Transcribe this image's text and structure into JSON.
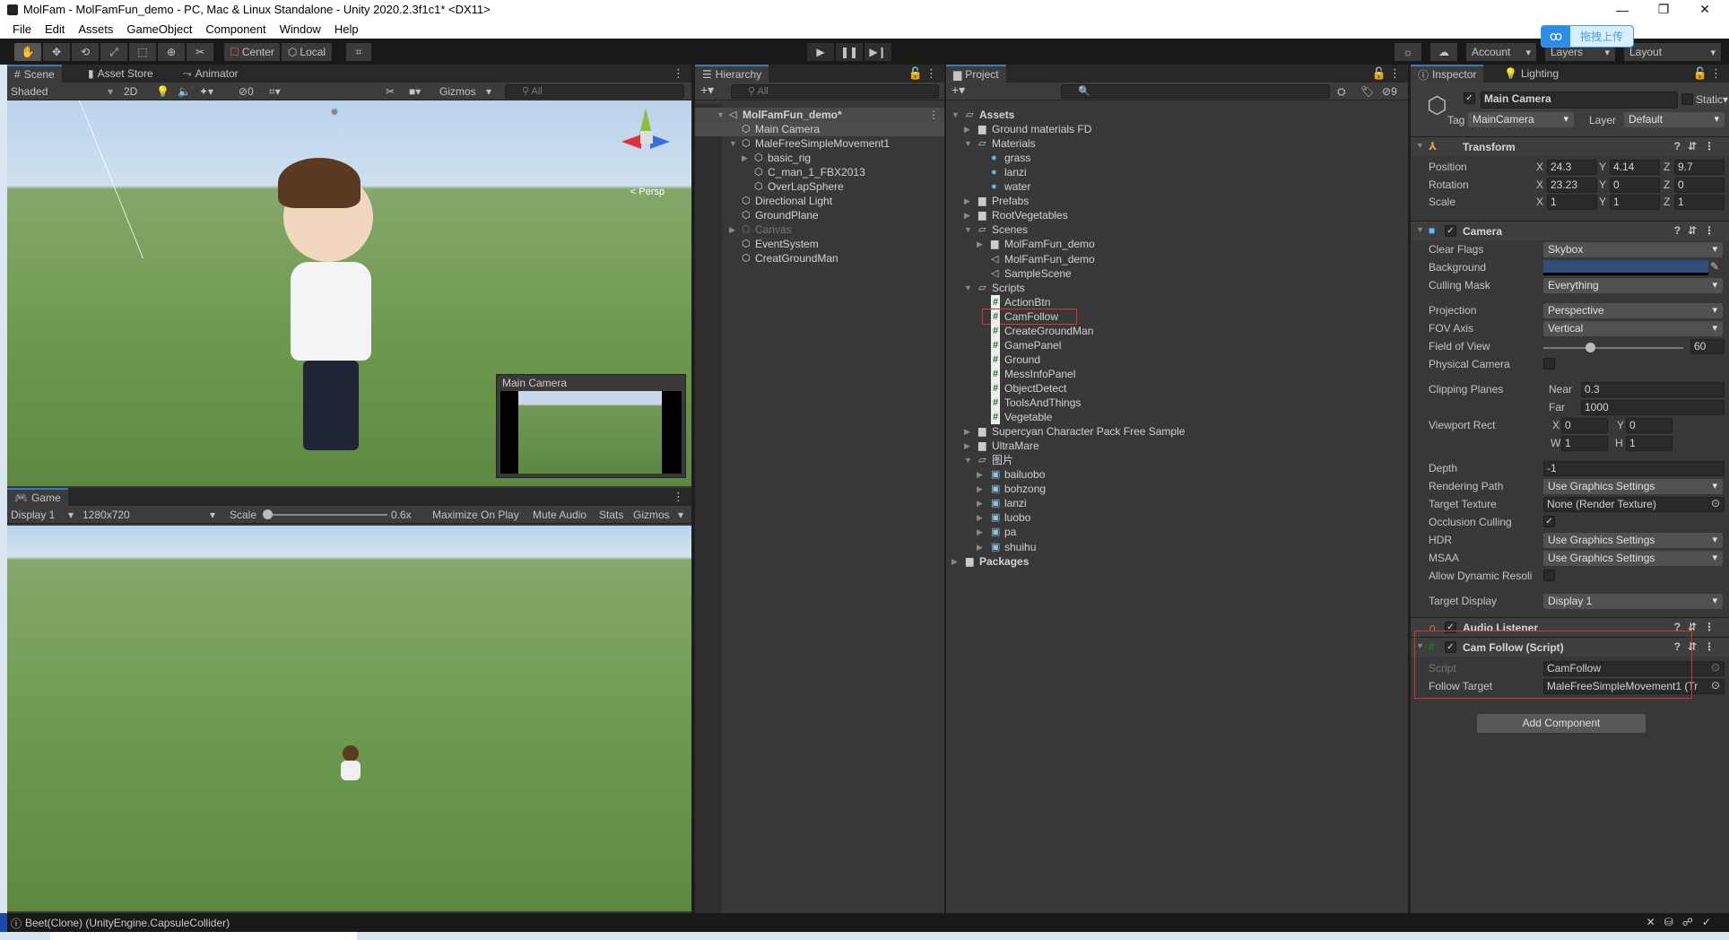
{
  "window": {
    "title": "MolFam - MolFamFun_demo - PC, Mac & Linux Standalone - Unity 2020.2.3f1c1* <DX11>",
    "minimize": "—",
    "restore": "❐",
    "close": "✕"
  },
  "menu": [
    "File",
    "Edit",
    "Assets",
    "GameObject",
    "Component",
    "Window",
    "Help"
  ],
  "toolbar": {
    "center": "Center",
    "local": "Local",
    "account": "Account",
    "layers": "Layers",
    "layout": "Layout",
    "upload": "拖拽上传"
  },
  "scene": {
    "tabs": [
      "Scene",
      "Asset Store",
      "Animator"
    ],
    "shading": "Shaded",
    "mode2d": "2D",
    "hidden_count": "0",
    "gizmos": "Gizmos",
    "search_placeholder": "All",
    "persp": "< Persp",
    "camera_preview_title": "Main Camera"
  },
  "game": {
    "tab": "Game",
    "display": "Display 1",
    "resolution": "1280x720",
    "scale_label": "Scale",
    "scale_value": "0.6x",
    "scale_fraction": 0.0,
    "buttons": [
      "Maximize On Play",
      "Mute Audio",
      "Stats",
      "Gizmos"
    ]
  },
  "hierarchy": {
    "tab": "Hierarchy",
    "search_placeholder": "All",
    "items": [
      {
        "label": "MolFamFun_demo*",
        "level": 0,
        "icon": "unity-scene-icon",
        "expanded": true,
        "bold": true
      },
      {
        "label": "Main Camera",
        "level": 1,
        "icon": "gameobject-icon",
        "selected": true
      },
      {
        "label": "MaleFreeSimpleMovement1",
        "level": 1,
        "icon": "gameobject-icon",
        "expanded": true
      },
      {
        "label": "basic_rig",
        "level": 2,
        "icon": "gameobject-icon",
        "collapsed": true
      },
      {
        "label": "C_man_1_FBX2013",
        "level": 2,
        "icon": "gameobject-icon"
      },
      {
        "label": "OverLapSphere",
        "level": 2,
        "icon": "gameobject-icon"
      },
      {
        "label": "Directional Light",
        "level": 1,
        "icon": "gameobject-icon"
      },
      {
        "label": "GroundPlane",
        "level": 1,
        "icon": "gameobject-icon"
      },
      {
        "label": "Canvas",
        "level": 1,
        "icon": "gameobject-icon",
        "collapsed": true,
        "disabled": true
      },
      {
        "label": "EventSystem",
        "level": 1,
        "icon": "gameobject-icon"
      },
      {
        "label": "CreatGroundMan",
        "level": 1,
        "icon": "gameobject-icon"
      }
    ]
  },
  "project": {
    "tab": "Project",
    "hidden_count": "9",
    "items": [
      {
        "label": "Assets",
        "level": 0,
        "icon": "folder-open-icon",
        "expanded": true,
        "bold": true
      },
      {
        "label": "Ground materials FD",
        "level": 1,
        "icon": "folder-icon",
        "collapsed": true
      },
      {
        "label": "Materials",
        "level": 1,
        "icon": "folder-open-icon",
        "expanded": true
      },
      {
        "label": "grass",
        "level": 2,
        "icon": "material-icon"
      },
      {
        "label": "lanzi",
        "level": 2,
        "icon": "material-icon"
      },
      {
        "label": "water",
        "level": 2,
        "icon": "material-icon"
      },
      {
        "label": "Prefabs",
        "level": 1,
        "icon": "folder-icon",
        "collapsed": true
      },
      {
        "label": "RootVegetables",
        "level": 1,
        "icon": "folder-icon",
        "collapsed": true
      },
      {
        "label": "Scenes",
        "level": 1,
        "icon": "folder-open-icon",
        "expanded": true
      },
      {
        "label": "MolFamFun_demo",
        "level": 2,
        "icon": "folder-icon",
        "collapsed": true
      },
      {
        "label": "MolFamFun_demo",
        "level": 2,
        "icon": "unity-scene-icon"
      },
      {
        "label": "SampleScene",
        "level": 2,
        "icon": "unity-scene-icon"
      },
      {
        "label": "Scripts",
        "level": 1,
        "icon": "folder-open-icon",
        "expanded": true
      },
      {
        "label": "ActionBtn",
        "level": 2,
        "icon": "csharp-script-icon"
      },
      {
        "label": "CamFollow",
        "level": 2,
        "icon": "csharp-script-icon",
        "highlighted": true
      },
      {
        "label": "CreateGroundMan",
        "level": 2,
        "icon": "csharp-script-icon"
      },
      {
        "label": "GamePanel",
        "level": 2,
        "icon": "csharp-script-icon"
      },
      {
        "label": "Ground",
        "level": 2,
        "icon": "csharp-script-icon"
      },
      {
        "label": "MessInfoPanel",
        "level": 2,
        "icon": "csharp-script-icon"
      },
      {
        "label": "ObjectDetect",
        "level": 2,
        "icon": "csharp-script-icon"
      },
      {
        "label": "ToolsAndThings",
        "level": 2,
        "icon": "csharp-script-icon"
      },
      {
        "label": "Vegetable",
        "level": 2,
        "icon": "csharp-script-icon"
      },
      {
        "label": "Supercyan Character Pack Free Sample",
        "level": 1,
        "icon": "folder-icon",
        "collapsed": true
      },
      {
        "label": "UltraMare",
        "level": 1,
        "icon": "folder-icon",
        "collapsed": true
      },
      {
        "label": "图片",
        "level": 1,
        "icon": "folder-open-icon",
        "expanded": true
      },
      {
        "label": "bailuobo",
        "level": 2,
        "icon": "image-thumbnail-icon",
        "collapsed": true
      },
      {
        "label": "bohzong",
        "level": 2,
        "icon": "image-thumbnail-icon",
        "collapsed": true
      },
      {
        "label": "lanzi",
        "level": 2,
        "icon": "image-thumbnail-icon",
        "collapsed": true
      },
      {
        "label": "luobo",
        "level": 2,
        "icon": "image-thumbnail-icon",
        "collapsed": true
      },
      {
        "label": "pa",
        "level": 2,
        "icon": "image-thumbnail-icon",
        "collapsed": true
      },
      {
        "label": "shuihu",
        "level": 2,
        "icon": "image-thumbnail-icon",
        "collapsed": true
      },
      {
        "label": "Packages",
        "level": 0,
        "icon": "folder-icon",
        "collapsed": true,
        "bold": true
      }
    ]
  },
  "inspector": {
    "tabs": [
      "Inspector",
      "Lighting"
    ],
    "object_name": "Main Camera",
    "active": true,
    "static_label": "Static",
    "tag_label": "Tag",
    "tag": "MainCamera",
    "layer_label": "Layer",
    "layer": "Default",
    "transform": {
      "title": "Transform",
      "rows": [
        {
          "label": "Position",
          "x": "24.3",
          "y": "4.14",
          "z": "9.7"
        },
        {
          "label": "Rotation",
          "x": "23.23",
          "y": "0",
          "z": "0"
        },
        {
          "label": "Scale",
          "x": "1",
          "y": "1",
          "z": "1"
        }
      ]
    },
    "camera": {
      "title": "Camera",
      "clear_flags_label": "Clear Flags",
      "clear_flags": "Skybox",
      "background_label": "Background",
      "background_color": "#314d79",
      "culling_mask_label": "Culling Mask",
      "culling_mask": "Everything",
      "projection_label": "Projection",
      "projection": "Perspective",
      "fov_axis_label": "FOV Axis",
      "fov_axis": "Vertical",
      "fov_label": "Field of View",
      "fov": "60",
      "fov_range": [
        1,
        179
      ],
      "physical_label": "Physical Camera",
      "clipping_label": "Clipping Planes",
      "near_label": "Near",
      "near": "0.3",
      "far_label": "Far",
      "far": "1000",
      "viewport_label": "Viewport Rect",
      "vx": "0",
      "vy": "0",
      "vw": "1",
      "vh": "1",
      "depth_label": "Depth",
      "depth": "-1",
      "rendering_path_label": "Rendering Path",
      "rendering_path": "Use Graphics Settings",
      "target_texture_label": "Target Texture",
      "target_texture": "None (Render Texture)",
      "occlusion_label": "Occlusion Culling",
      "hdr_label": "HDR",
      "hdr": "Use Graphics Settings",
      "msaa_label": "MSAA",
      "msaa": "Use Graphics Settings",
      "dynamic_res_label": "Allow Dynamic Resoli",
      "target_display_label": "Target Display",
      "target_display": "Display 1"
    },
    "audio_listener": {
      "title": "Audio Listener"
    },
    "cam_follow": {
      "title": "Cam Follow (Script)",
      "script_label": "Script",
      "script": "CamFollow",
      "follow_target_label": "Follow Target",
      "follow_target": "MaleFreeSimpleMovement1 (Tr"
    },
    "add_component": "Add Component"
  },
  "status": {
    "message": "Beet(Clone) (UnityEngine.CapsuleCollider)"
  },
  "colors": {
    "highlight": "#e03030",
    "accent": "#3a79bb"
  }
}
